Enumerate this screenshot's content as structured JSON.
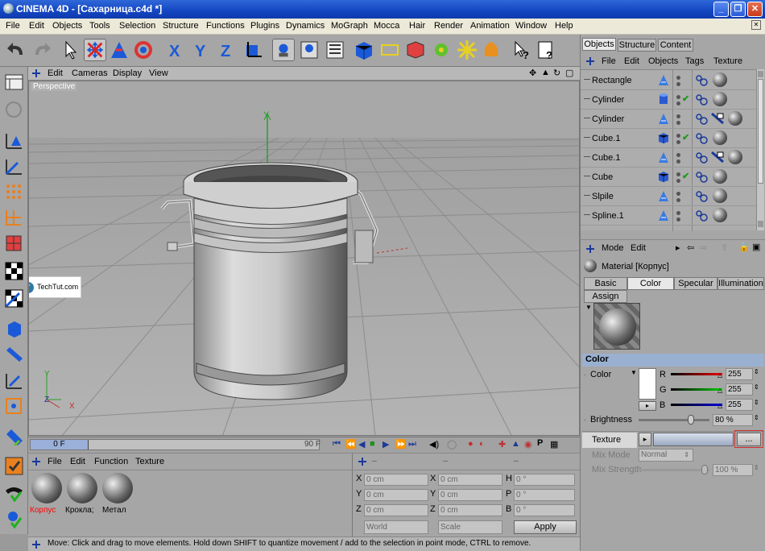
{
  "window": {
    "title": "CINEMA 4D - [Сахарница.c4d *]"
  },
  "menu": [
    "File",
    "Edit",
    "Objects",
    "Tools",
    "Selection",
    "Structure",
    "Functions",
    "Plugins",
    "Dynamics",
    "MoGraph",
    "Mocca",
    "Hair",
    "Render",
    "Animation",
    "Window",
    "Help"
  ],
  "viewport": {
    "menu": [
      "Edit",
      "Cameras",
      "Display",
      "View"
    ],
    "label": "Perspective",
    "axis_y": "Y",
    "axis_small_y": "Y",
    "axis_small_z": "Z",
    "axis_small_x": "X",
    "watermark": "TechTut.com"
  },
  "timeline": {
    "current_frame": "0 F",
    "end_frame": "90 F"
  },
  "materials": {
    "menu": [
      "File",
      "Edit",
      "Function",
      "Texture"
    ],
    "items": [
      {
        "name": "Корпус",
        "color": "#ff0000"
      },
      {
        "name": "Крокла;",
        "color": "#000000"
      },
      {
        "name": "Метал",
        "color": "#000000"
      }
    ]
  },
  "coordinates": {
    "headers": [
      "--",
      "--",
      "--"
    ],
    "rows": [
      {
        "a": "X",
        "av": "0 cm",
        "b": "X",
        "bv": "0 cm",
        "c": "H",
        "cv": "0 °"
      },
      {
        "a": "Y",
        "av": "0 cm",
        "b": "Y",
        "bv": "0 cm",
        "c": "P",
        "cv": "0 °"
      },
      {
        "a": "Z",
        "av": "0 cm",
        "b": "Z",
        "bv": "0 cm",
        "c": "B",
        "cv": "0 °"
      }
    ],
    "space": "World",
    "mode": "Scale",
    "apply": "Apply"
  },
  "status": "Move: Click and drag to move elements. Hold down SHIFT to quantize movement / add to the selection in point mode, CTRL to remove.",
  "objects_panel": {
    "tabs": [
      "Objects",
      "Structure",
      "Content"
    ],
    "menu": [
      "File",
      "Edit",
      "Objects",
      "Tags",
      "Texture"
    ],
    "items": [
      {
        "name": "Rectangle",
        "icon": "spline-icon",
        "check": false,
        "texture": "sphere"
      },
      {
        "name": "Cylinder",
        "icon": "cylinder-icon",
        "check": true,
        "texture": "sphere"
      },
      {
        "name": "Cylinder",
        "icon": "spline-icon",
        "check": false,
        "texture": "sphere2"
      },
      {
        "name": "Cube.1",
        "icon": "cube-icon",
        "check": true,
        "texture": "sphere"
      },
      {
        "name": "Cube.1",
        "icon": "spline-icon",
        "check": false,
        "texture": "sphere2"
      },
      {
        "name": "Cube",
        "icon": "cube-icon",
        "check": true,
        "texture": "sphere"
      },
      {
        "name": "Slpile",
        "icon": "spline-icon",
        "check": false,
        "texture": "sphere"
      },
      {
        "name": "Spline.1",
        "icon": "spline-icon",
        "check": false,
        "texture": "sphere"
      }
    ]
  },
  "attributes": {
    "menu": [
      "Mode",
      "Edit"
    ],
    "material_title": "Material [Корпус]",
    "tabs": [
      "Basic",
      "Color",
      "Specular",
      "Illumination",
      "Assign"
    ],
    "section": "Color",
    "color_label": "Color",
    "r_label": "R",
    "r_value": "255",
    "g_label": "G",
    "g_value": "255",
    "b_label": "B",
    "b_value": "255",
    "brightness_label": "Brightness",
    "brightness_value": "80 %",
    "texture_label": "Texture",
    "texture_button": "...",
    "mix_mode_label": "Mix Mode",
    "mix_mode_value": "Normal",
    "mix_strength_label": "Mix Strength",
    "mix_strength_value": "100 %"
  }
}
